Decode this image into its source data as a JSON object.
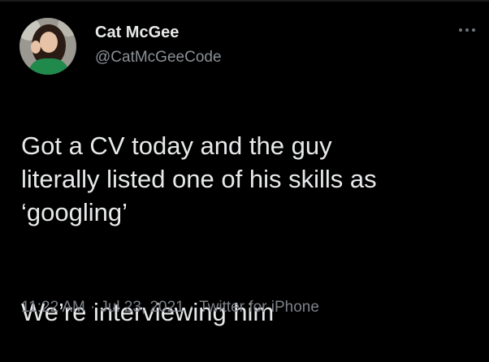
{
  "tweet": {
    "author_name": "Cat McGee",
    "author_handle": "@CatMcGeeCode",
    "more_icon": "more-horizontal-icon",
    "text_paragraphs": [
      "Got a CV today and the guy\nliterally listed one of his skills as\n‘googling’",
      "We’re interviewing him"
    ],
    "time": "11:22 AM",
    "date": "Jul 23, 2021",
    "source": "Twitter for iPhone",
    "separator": "·"
  },
  "colors": {
    "background": "#000000",
    "primary_text": "#e7e9ea",
    "secondary_text": "#8b9096"
  }
}
